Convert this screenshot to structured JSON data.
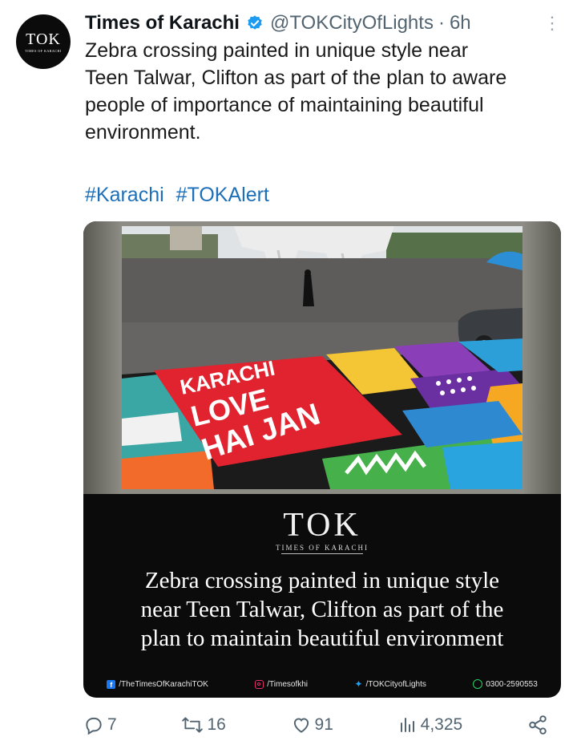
{
  "author": {
    "avatar_text": "TOK",
    "avatar_subtext": "TIMES OF KARACHI",
    "name": "Times of Karachi",
    "handle": "@TOKCityOfLights",
    "separator": "·",
    "time": "6h"
  },
  "tweet": {
    "text": "Zebra crossing painted in unique style near\nTeen Talwar, Clifton as part of the plan to aware\npeople of importance of maintaining beautiful\nenvironment.",
    "hashtags": [
      "#Karachi",
      "#TOKAlert"
    ]
  },
  "media": {
    "crossing_lines": [
      "KARACHI",
      "LOVE",
      "HAI JAN"
    ],
    "logo": "TOK",
    "logo_sub": "TIMES OF KARACHI",
    "caption": "Zebra crossing painted in unique style\nnear Teen Talwar, Clifton as part of the\nplan to maintain beautiful environment",
    "footer": {
      "facebook": "/TheTimesOfKarachiTOK",
      "instagram": "/Timesofkhi",
      "twitter": "/TOKCityofLights",
      "whatsapp": "0300-2590553"
    }
  },
  "actions": {
    "replies": "7",
    "reposts": "16",
    "likes": "91",
    "views": "4,325"
  },
  "colors": {
    "hashtag": "#1d6fb8",
    "verified": "#1d9bf0",
    "muted": "#536471"
  }
}
